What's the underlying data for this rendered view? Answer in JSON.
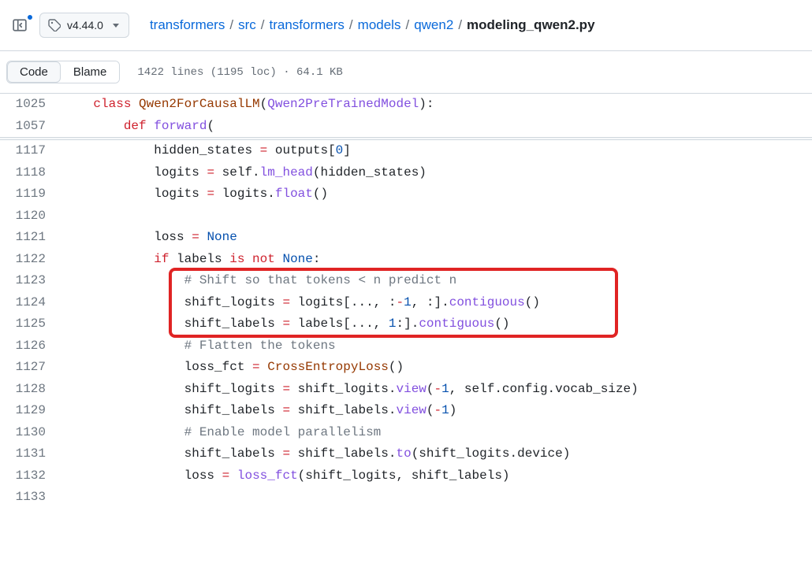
{
  "header": {
    "branch_tag": "v4.44.0",
    "breadcrumbs": [
      {
        "label": "transformers",
        "link": true
      },
      {
        "label": "src",
        "link": true
      },
      {
        "label": "transformers",
        "link": true
      },
      {
        "label": "models",
        "link": true
      },
      {
        "label": "qwen2",
        "link": true
      },
      {
        "label": "modeling_qwen2.py",
        "link": false
      }
    ]
  },
  "toolbar": {
    "tab_code": "Code",
    "tab_blame": "Blame",
    "file_info": "1422 lines (1195 loc) · 64.1 KB"
  },
  "code": {
    "lines": [
      {
        "num": "1025",
        "indent": 1
      },
      {
        "num": "1057",
        "indent": 2
      },
      {
        "divider": true
      },
      {
        "num": "1117",
        "indent": 3
      },
      {
        "num": "1118",
        "indent": 3
      },
      {
        "num": "1119",
        "indent": 3
      },
      {
        "num": "1120",
        "indent": 0
      },
      {
        "num": "1121",
        "indent": 3
      },
      {
        "num": "1122",
        "indent": 3
      },
      {
        "num": "1123",
        "indent": 4
      },
      {
        "num": "1124",
        "indent": 4
      },
      {
        "num": "1125",
        "indent": 4
      },
      {
        "num": "1126",
        "indent": 4
      },
      {
        "num": "1127",
        "indent": 4
      },
      {
        "num": "1128",
        "indent": 4
      },
      {
        "num": "1129",
        "indent": 4
      },
      {
        "num": "1130",
        "indent": 4
      },
      {
        "num": "1131",
        "indent": 4
      },
      {
        "num": "1132",
        "indent": 4
      },
      {
        "num": "1133",
        "indent": 0
      }
    ],
    "tokens": {
      "l1025": [
        [
          "kw",
          "class "
        ],
        [
          "cls",
          "Qwen2ForCausalLM"
        ],
        [
          "",
          "("
        ],
        [
          "fn",
          "Qwen2PreTrainedModel"
        ],
        [
          "",
          "):"
        ]
      ],
      "l1057": [
        [
          "kw",
          "def "
        ],
        [
          "fn",
          "forward"
        ],
        [
          "",
          "("
        ]
      ],
      "l1117": [
        [
          "",
          "hidden_states "
        ],
        [
          "op",
          "="
        ],
        [
          "",
          " outputs["
        ],
        [
          "pk",
          "0"
        ],
        [
          "",
          "]"
        ]
      ],
      "l1118": [
        [
          "",
          "logits "
        ],
        [
          "op",
          "="
        ],
        [
          "",
          " self."
        ],
        [
          "fn",
          "lm_head"
        ],
        [
          "",
          "(hidden_states)"
        ]
      ],
      "l1119": [
        [
          "",
          "logits "
        ],
        [
          "op",
          "="
        ],
        [
          "",
          " logits."
        ],
        [
          "fn",
          "float"
        ],
        [
          "",
          "()"
        ]
      ],
      "l1120": [],
      "l1121": [
        [
          "",
          "loss "
        ],
        [
          "op",
          "="
        ],
        [
          "",
          " "
        ],
        [
          "pk",
          "None"
        ]
      ],
      "l1122": [
        [
          "kw",
          "if"
        ],
        [
          "",
          " labels "
        ],
        [
          "kw",
          "is"
        ],
        [
          "",
          " "
        ],
        [
          "kw",
          "not"
        ],
        [
          "",
          " "
        ],
        [
          "pk",
          "None"
        ],
        [
          "",
          ":"
        ]
      ],
      "l1123": [
        [
          "cm",
          "# Shift so that tokens < n predict n"
        ]
      ],
      "l1124": [
        [
          "",
          "shift_logits "
        ],
        [
          "op",
          "="
        ],
        [
          "",
          " logits[..., :"
        ],
        [
          "op",
          "-"
        ],
        [
          "pk",
          "1"
        ],
        [
          "",
          ", :]."
        ],
        [
          "fn",
          "contiguous"
        ],
        [
          "",
          "()"
        ]
      ],
      "l1125": [
        [
          "",
          "shift_labels "
        ],
        [
          "op",
          "="
        ],
        [
          "",
          " labels[..., "
        ],
        [
          "pk",
          "1"
        ],
        [
          "",
          ":]."
        ],
        [
          "fn",
          "contiguous"
        ],
        [
          "",
          "()"
        ]
      ],
      "l1126": [
        [
          "cm",
          "# Flatten the tokens"
        ]
      ],
      "l1127": [
        [
          "",
          "loss_fct "
        ],
        [
          "op",
          "="
        ],
        [
          "",
          " "
        ],
        [
          "cls",
          "CrossEntropyLoss"
        ],
        [
          "",
          "()"
        ]
      ],
      "l1128": [
        [
          "",
          "shift_logits "
        ],
        [
          "op",
          "="
        ],
        [
          "",
          " shift_logits."
        ],
        [
          "fn",
          "view"
        ],
        [
          "",
          "("
        ],
        [
          "op",
          "-"
        ],
        [
          "pk",
          "1"
        ],
        [
          "",
          ", self.config.vocab_size)"
        ]
      ],
      "l1129": [
        [
          "",
          "shift_labels "
        ],
        [
          "op",
          "="
        ],
        [
          "",
          " shift_labels."
        ],
        [
          "fn",
          "view"
        ],
        [
          "",
          "("
        ],
        [
          "op",
          "-"
        ],
        [
          "pk",
          "1"
        ],
        [
          "",
          ")"
        ]
      ],
      "l1130": [
        [
          "cm",
          "# Enable model parallelism"
        ]
      ],
      "l1131": [
        [
          "",
          "shift_labels "
        ],
        [
          "op",
          "="
        ],
        [
          "",
          " shift_labels."
        ],
        [
          "fn",
          "to"
        ],
        [
          "",
          "(shift_logits.device)"
        ]
      ],
      "l1132": [
        [
          "",
          "loss "
        ],
        [
          "op",
          "="
        ],
        [
          "",
          " "
        ],
        [
          "fn",
          "loss_fct"
        ],
        [
          "",
          "(shift_logits, shift_labels)"
        ]
      ],
      "l1133": []
    },
    "highlight": {
      "start_line": "1123",
      "end_line": "1125"
    }
  }
}
